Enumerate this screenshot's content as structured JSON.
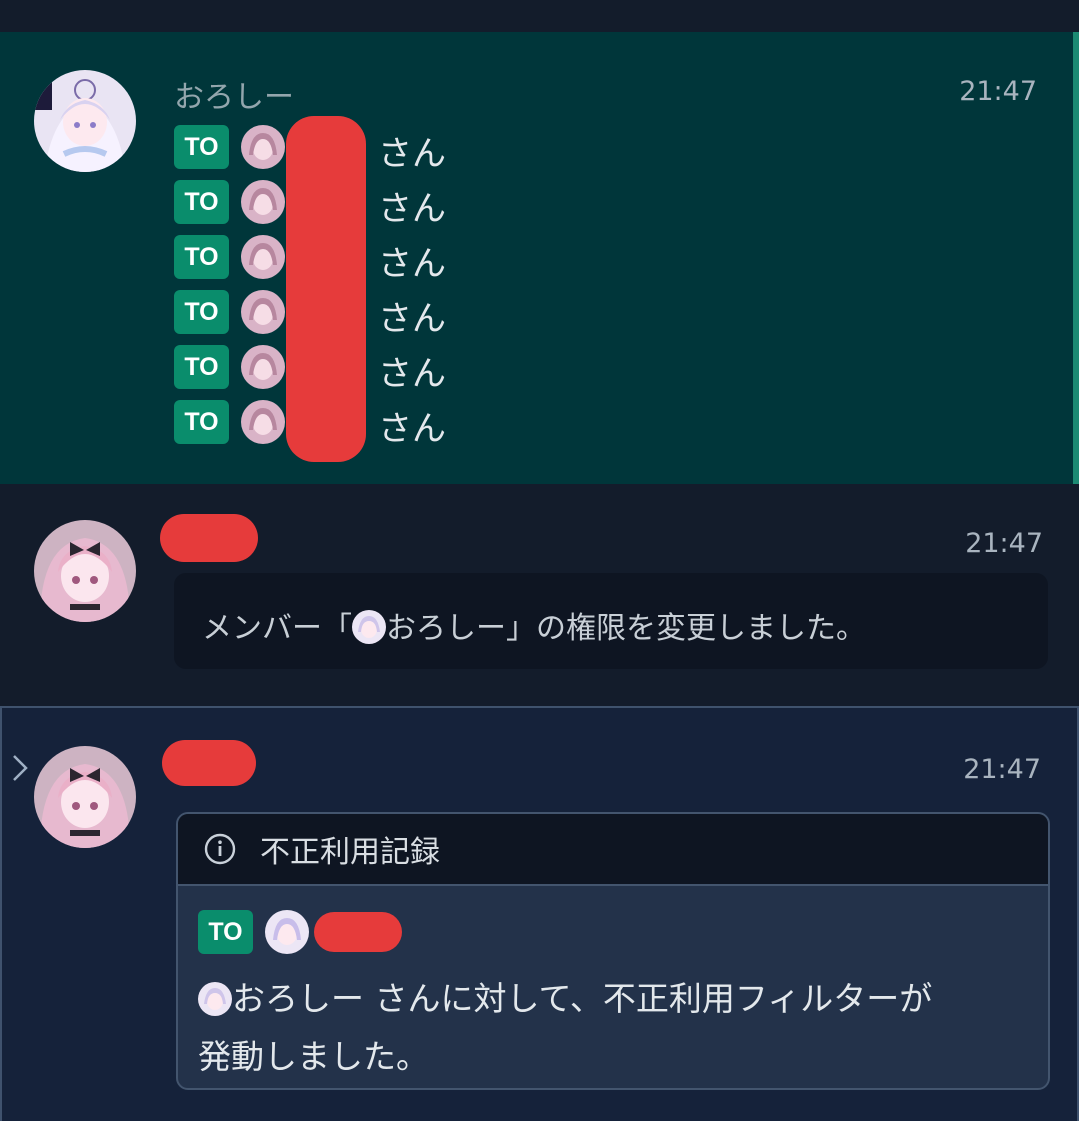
{
  "messages": [
    {
      "sender": "おろしー",
      "time": "21:47",
      "mention_label": "TO",
      "suffix": "さん",
      "mentions": [
        {
          "suffix": "さん"
        },
        {
          "suffix": "さん"
        },
        {
          "suffix": "さん"
        },
        {
          "suffix": "さん"
        },
        {
          "suffix": "さん"
        },
        {
          "suffix": "さん"
        }
      ]
    },
    {
      "time": "21:47",
      "text_before": "メンバー「",
      "text_name": "おろしー",
      "text_after": "」の権限を変更しました。"
    },
    {
      "time": "21:47",
      "alert_title": "不正利用記録",
      "mention_label": "TO",
      "body_name": "おろしー",
      "body_line1_rest": " さんに対して、不正利用フィルターが",
      "body_line2": "発動しました。"
    }
  ],
  "icons": {
    "info": "info-circle-icon",
    "expand": "chevron-right-icon"
  },
  "colors": {
    "accent": "#0a8d6c",
    "highlight_bg": "#00363a",
    "redaction": "#e63b3b"
  }
}
